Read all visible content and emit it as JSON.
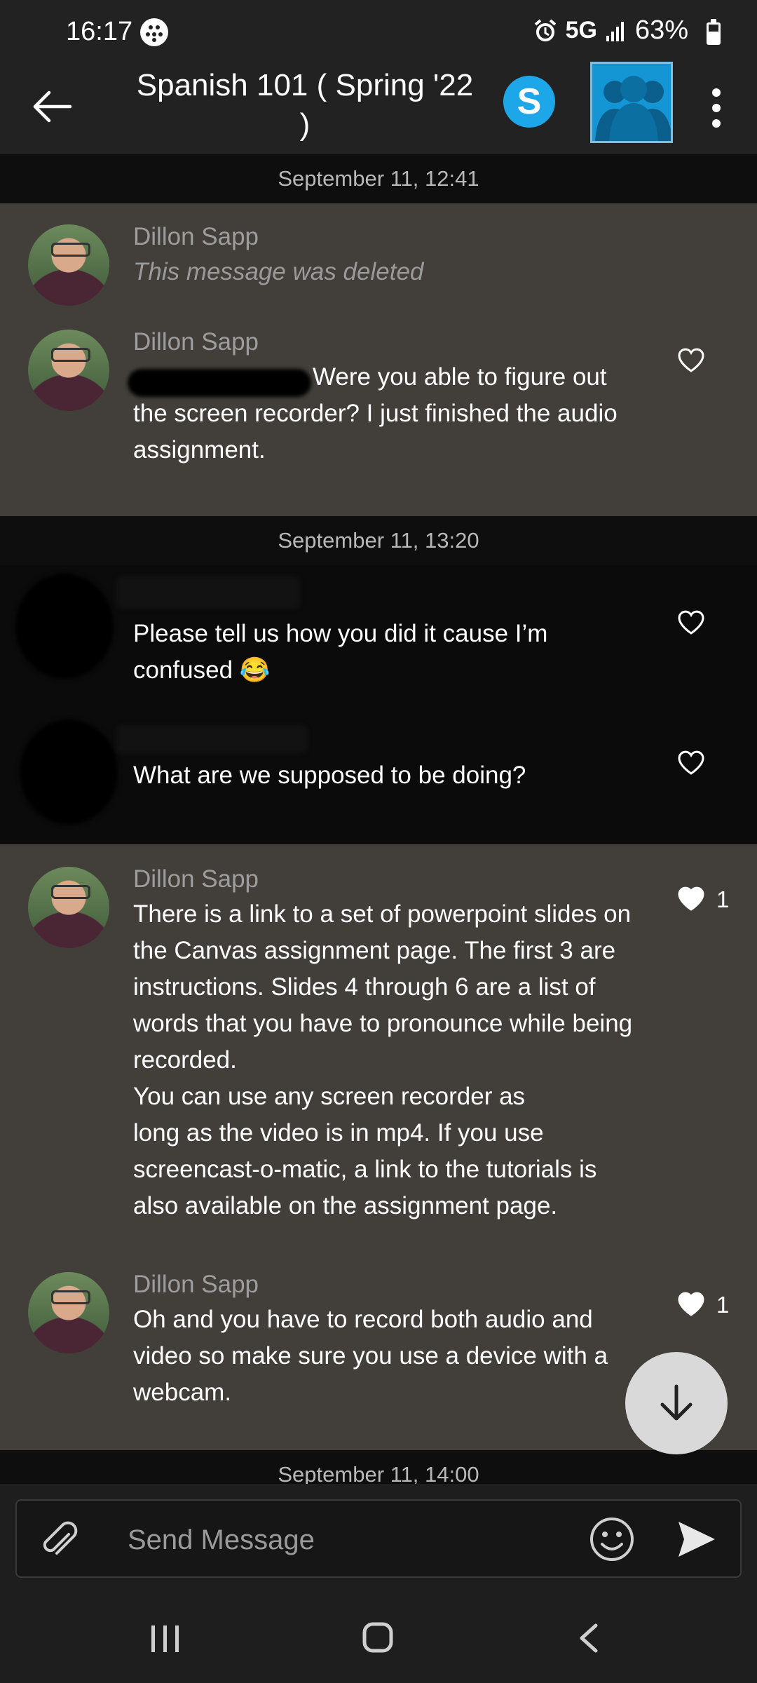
{
  "status_bar": {
    "time": "16:17",
    "network": "5G",
    "battery": "63%",
    "icons": [
      "alarm-icon",
      "signal-icon",
      "battery-icon"
    ]
  },
  "header": {
    "title": "Spanish 101 ( Spring '22 )",
    "icons": [
      "back-arrow-icon",
      "skype-icon",
      "group-avatar-icon",
      "more-vert-icon"
    ],
    "skype_letter": "S"
  },
  "messages": [
    {
      "type": "date",
      "text": "September 11, 12:41"
    },
    {
      "type": "message",
      "sender": "Dillon Sapp",
      "text": "This message was deleted",
      "deleted": true
    },
    {
      "type": "message",
      "sender": "Dillon Sapp",
      "text": "Were you able to figure out\nthe screen recorder? I just finished the audio\nassignment.",
      "likes": null
    },
    {
      "type": "date",
      "text": "September 11, 13:20"
    },
    {
      "type": "message",
      "sender": "",
      "text": "Please tell us how you did it cause I’m\nconfused 😂",
      "likes": null
    },
    {
      "type": "message",
      "sender": "",
      "text": "What are we supposed to be doing?",
      "likes": null
    },
    {
      "type": "message",
      "sender": "Dillon Sapp",
      "text": "There is a link to a set of powerpoint slides on\nthe Canvas assignment page. The first 3 are\ninstructions. Slides 4 through 6 are a list of\nwords that you have to pronounce while being\nrecorded.\nYou can use any screen recorder as\nlong as the video is in mp4. If you use\nscreencast-o-matic, a link to the tutorials is\nalso available on the assignment page.",
      "likes": "1"
    },
    {
      "type": "message",
      "sender": "Dillon Sapp",
      "text": "Oh and you have to record both audio and\nvideo so make sure you use a device with a\nwebcam.",
      "likes": "1"
    },
    {
      "type": "date",
      "text": "September 11, 14:00"
    }
  ],
  "composer": {
    "placeholder": "Send Message",
    "value": ""
  },
  "colors": {
    "own_message_bg": "#423f3a",
    "other_message_bg": "#0b0b0b",
    "bar_bg": "#222222",
    "skype_blue": "#1ea7e8",
    "group_avatar_blue": "#1496d4"
  }
}
